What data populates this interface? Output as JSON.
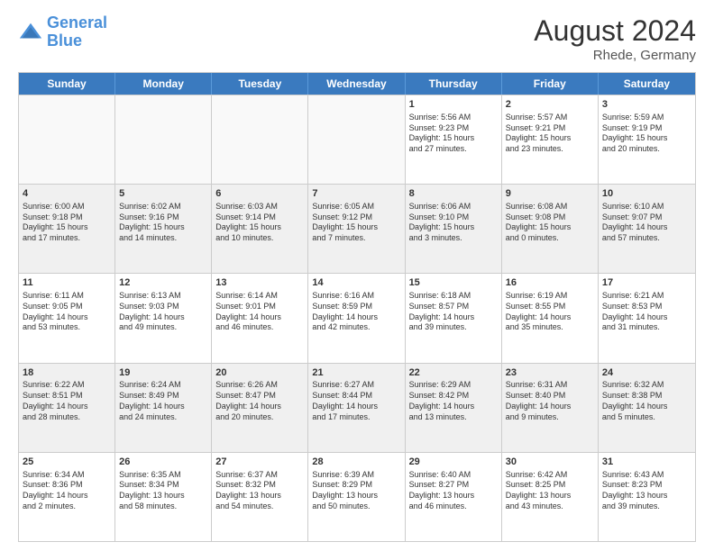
{
  "header": {
    "logo_line1": "General",
    "logo_line2": "Blue",
    "month_year": "August 2024",
    "location": "Rhede, Germany"
  },
  "days_of_week": [
    "Sunday",
    "Monday",
    "Tuesday",
    "Wednesday",
    "Thursday",
    "Friday",
    "Saturday"
  ],
  "weeks": [
    [
      {
        "day": "",
        "info": ""
      },
      {
        "day": "",
        "info": ""
      },
      {
        "day": "",
        "info": ""
      },
      {
        "day": "",
        "info": ""
      },
      {
        "day": "1",
        "info": "Sunrise: 5:56 AM\nSunset: 9:23 PM\nDaylight: 15 hours\nand 27 minutes."
      },
      {
        "day": "2",
        "info": "Sunrise: 5:57 AM\nSunset: 9:21 PM\nDaylight: 15 hours\nand 23 minutes."
      },
      {
        "day": "3",
        "info": "Sunrise: 5:59 AM\nSunset: 9:19 PM\nDaylight: 15 hours\nand 20 minutes."
      }
    ],
    [
      {
        "day": "4",
        "info": "Sunrise: 6:00 AM\nSunset: 9:18 PM\nDaylight: 15 hours\nand 17 minutes."
      },
      {
        "day": "5",
        "info": "Sunrise: 6:02 AM\nSunset: 9:16 PM\nDaylight: 15 hours\nand 14 minutes."
      },
      {
        "day": "6",
        "info": "Sunrise: 6:03 AM\nSunset: 9:14 PM\nDaylight: 15 hours\nand 10 minutes."
      },
      {
        "day": "7",
        "info": "Sunrise: 6:05 AM\nSunset: 9:12 PM\nDaylight: 15 hours\nand 7 minutes."
      },
      {
        "day": "8",
        "info": "Sunrise: 6:06 AM\nSunset: 9:10 PM\nDaylight: 15 hours\nand 3 minutes."
      },
      {
        "day": "9",
        "info": "Sunrise: 6:08 AM\nSunset: 9:08 PM\nDaylight: 15 hours\nand 0 minutes."
      },
      {
        "day": "10",
        "info": "Sunrise: 6:10 AM\nSunset: 9:07 PM\nDaylight: 14 hours\nand 57 minutes."
      }
    ],
    [
      {
        "day": "11",
        "info": "Sunrise: 6:11 AM\nSunset: 9:05 PM\nDaylight: 14 hours\nand 53 minutes."
      },
      {
        "day": "12",
        "info": "Sunrise: 6:13 AM\nSunset: 9:03 PM\nDaylight: 14 hours\nand 49 minutes."
      },
      {
        "day": "13",
        "info": "Sunrise: 6:14 AM\nSunset: 9:01 PM\nDaylight: 14 hours\nand 46 minutes."
      },
      {
        "day": "14",
        "info": "Sunrise: 6:16 AM\nSunset: 8:59 PM\nDaylight: 14 hours\nand 42 minutes."
      },
      {
        "day": "15",
        "info": "Sunrise: 6:18 AM\nSunset: 8:57 PM\nDaylight: 14 hours\nand 39 minutes."
      },
      {
        "day": "16",
        "info": "Sunrise: 6:19 AM\nSunset: 8:55 PM\nDaylight: 14 hours\nand 35 minutes."
      },
      {
        "day": "17",
        "info": "Sunrise: 6:21 AM\nSunset: 8:53 PM\nDaylight: 14 hours\nand 31 minutes."
      }
    ],
    [
      {
        "day": "18",
        "info": "Sunrise: 6:22 AM\nSunset: 8:51 PM\nDaylight: 14 hours\nand 28 minutes."
      },
      {
        "day": "19",
        "info": "Sunrise: 6:24 AM\nSunset: 8:49 PM\nDaylight: 14 hours\nand 24 minutes."
      },
      {
        "day": "20",
        "info": "Sunrise: 6:26 AM\nSunset: 8:47 PM\nDaylight: 14 hours\nand 20 minutes."
      },
      {
        "day": "21",
        "info": "Sunrise: 6:27 AM\nSunset: 8:44 PM\nDaylight: 14 hours\nand 17 minutes."
      },
      {
        "day": "22",
        "info": "Sunrise: 6:29 AM\nSunset: 8:42 PM\nDaylight: 14 hours\nand 13 minutes."
      },
      {
        "day": "23",
        "info": "Sunrise: 6:31 AM\nSunset: 8:40 PM\nDaylight: 14 hours\nand 9 minutes."
      },
      {
        "day": "24",
        "info": "Sunrise: 6:32 AM\nSunset: 8:38 PM\nDaylight: 14 hours\nand 5 minutes."
      }
    ],
    [
      {
        "day": "25",
        "info": "Sunrise: 6:34 AM\nSunset: 8:36 PM\nDaylight: 14 hours\nand 2 minutes."
      },
      {
        "day": "26",
        "info": "Sunrise: 6:35 AM\nSunset: 8:34 PM\nDaylight: 13 hours\nand 58 minutes."
      },
      {
        "day": "27",
        "info": "Sunrise: 6:37 AM\nSunset: 8:32 PM\nDaylight: 13 hours\nand 54 minutes."
      },
      {
        "day": "28",
        "info": "Sunrise: 6:39 AM\nSunset: 8:29 PM\nDaylight: 13 hours\nand 50 minutes."
      },
      {
        "day": "29",
        "info": "Sunrise: 6:40 AM\nSunset: 8:27 PM\nDaylight: 13 hours\nand 46 minutes."
      },
      {
        "day": "30",
        "info": "Sunrise: 6:42 AM\nSunset: 8:25 PM\nDaylight: 13 hours\nand 43 minutes."
      },
      {
        "day": "31",
        "info": "Sunrise: 6:43 AM\nSunset: 8:23 PM\nDaylight: 13 hours\nand 39 minutes."
      }
    ]
  ]
}
